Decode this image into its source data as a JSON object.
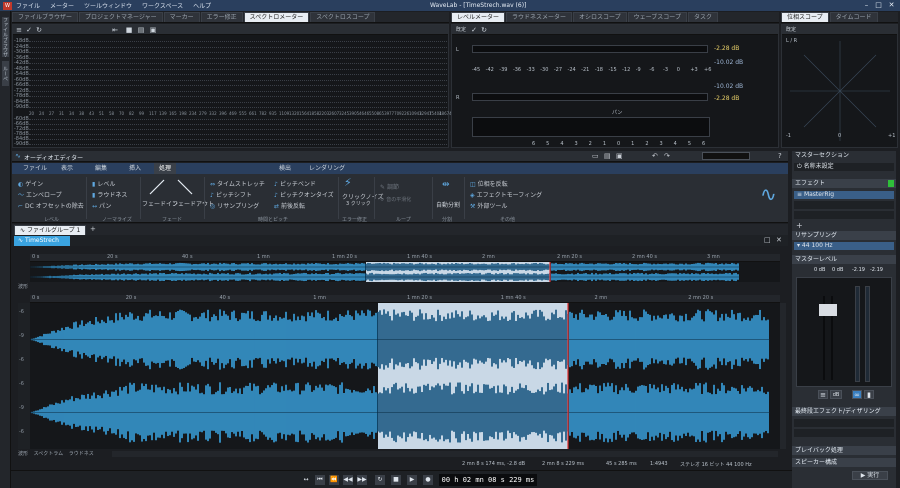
{
  "menu": {
    "items": [
      "ファイル",
      "メーター",
      "ツールウィンドウ",
      "ワークスペース",
      "ヘルプ"
    ],
    "title": "WaveLab - [TimeStrech.wav (6)]"
  },
  "left_strip": {
    "labels": [
      "ファイルブラウザー",
      "ルーペ",
      "TimeStrech"
    ]
  },
  "top_tabs_left": [
    "ファイルブラウザー",
    "プロジェクトマネージャー",
    "マーカー",
    "エラー修正",
    "スペクトロメーター",
    "スペクトロスコープ"
  ],
  "top_tabs_mid": [
    "レベルメーター",
    "ラウドネスメーター",
    "オシロスコープ",
    "ウェーブスコープ",
    "タスク"
  ],
  "top_tabs_right": [
    "位相スコープ",
    "タイムコード"
  ],
  "spectro": {
    "db_labels": [
      "-18dB",
      "-24dB",
      "-30dB",
      "-36dB",
      "-42dB",
      "-48dB",
      "-54dB",
      "-60dB",
      "-66dB",
      "-72dB",
      "-78dB",
      "-84dB",
      "-90dB"
    ],
    "freq_labels": [
      "20 Hz",
      "24 Hz",
      "27 Hz",
      "31 Hz",
      "34 Hz",
      "38 Hz",
      "43 Hz",
      "51 Hz",
      "58 Hz",
      "70 Hz",
      "82 Hz",
      "99 Hz",
      "117 Hz",
      "139 Hz",
      "165 Hz",
      "198 Hz",
      "234 Hz",
      "279 Hz",
      "332 Hz",
      "396 Hz",
      "469 Hz",
      "555 Hz",
      "661 Hz",
      "782 Hz",
      "935 Hz",
      "1109 Hz",
      "1320 Hz",
      "1564 Hz",
      "1858 Hz",
      "2203 Hz",
      "2607 Hz",
      "3245 Hz",
      "3905 Hz",
      "4646 Hz",
      "5508 Hz",
      "6539 Hz",
      "7770 Hz",
      "9226 Hz",
      "10943 Hz",
      "12947 Hz",
      "15404 Hz",
      "18674 Hz"
    ],
    "db_labels2": [
      "-60dB",
      "-66dB",
      "-72dB",
      "-78dB",
      "-84dB",
      "-90dB"
    ]
  },
  "level_meter": {
    "label_l": "L",
    "label_r": "R",
    "scale": [
      "-45",
      "-42",
      "-39",
      "-36",
      "-33",
      "-30",
      "-27",
      "-24",
      "-21",
      "-18",
      "-15",
      "-12",
      "-9",
      "-6",
      "-3",
      "0",
      "+3",
      "+6"
    ],
    "l_peak": "-2.28 dB",
    "l_rms": "-10.02 dB",
    "r_rms": "-10.02 dB",
    "r_peak": "-2.28 dB",
    "pan_label": "パン",
    "pan_scale": [
      "6",
      "5",
      "4",
      "3",
      "2",
      "1",
      "0",
      "1",
      "2",
      "3",
      "4",
      "5",
      "6"
    ],
    "mode_label": "既定"
  },
  "phase_scope": {
    "label": "L / R",
    "mode_label": "既定",
    "scale": [
      "-1",
      "0",
      "+1"
    ]
  },
  "editor": {
    "title": "オーディオエディター",
    "ribbon_tabs": [
      "ファイル",
      "表示",
      "編集",
      "挿入",
      "処理",
      "検出",
      "レンダリング"
    ],
    "active_tab": "処理",
    "buttons": {
      "gain": "ゲイン",
      "envelope": "エンベロープ",
      "dc": "DC オフセットの除去",
      "level": "レベル",
      "loudness": "ラウドネス",
      "pan": "パン",
      "fade_in": "フェードイン",
      "fade_out": "フェードアウト",
      "time_stretch": "タイムストレッチ",
      "pitch_shift": "ピッチシフト",
      "resample": "リサンプリング",
      "pitch_bend": "ピッチベンド",
      "pitch_quantize": "ピッチクオンタイズ",
      "reverse": "前後反転",
      "click_noise": "クリックノイズ",
      "three_click": "3 クリック",
      "adjust": "調節",
      "loop_info": "音の平滑化",
      "auto_split": "自動分割",
      "phase_reverse": "位相を反転",
      "effect_morph": "エフェクトモーフィング",
      "external_tool": "外部ツール"
    },
    "groups": [
      "レベル",
      "ノーマライズ",
      "フェード",
      "時間とピッチ",
      "エラー修正",
      "ループ",
      "分割",
      "その他"
    ],
    "file_group": "ファイルグループ 1",
    "file_tab": "TimeStrech",
    "overview_ruler": [
      "0 s",
      "20 s",
      "40 s",
      "1 mn",
      "1 mn 20 s",
      "1 mn 40 s",
      "2 mn",
      "2 mn 20 s",
      "2 mn 40 s",
      "3 mn"
    ],
    "main_ruler": [
      "0 s",
      "20 s",
      "40 s",
      "1 mn",
      "1 mn 20 s",
      "1 mn 40 s",
      "2 mn",
      "2 mn 20 s"
    ],
    "mini_tabs": [
      "波形",
      "スペクトラム",
      "ラウドネス"
    ],
    "db_axis": [
      "-6",
      "-9",
      "-6",
      "-6",
      "-9",
      "-6"
    ],
    "status": {
      "duration": "2 mn 8 s 174 ms, -2.8 dB",
      "cursor": "2 mn 8 s 229 ms",
      "sel": "45 s 285 ms",
      "zoom": "1:4943",
      "format": "ステレオ 16 ビット 44 100 Hz"
    }
  },
  "master": {
    "title": "マスターセクション",
    "preset": "名称未設定",
    "effects_label": "エフェクト",
    "plugin": "MasterRig",
    "resample_label": "リサンプリング",
    "resample_value": "44 100 Hz",
    "master_level": "マスターレベル",
    "vals": [
      "0 dB",
      "0 dB",
      "-2.19",
      "-2.19"
    ],
    "dither_label": "最終段エフェクト/ディザリング",
    "playback_label": "プレイバック処理",
    "speaker_label": "スピーカー構成",
    "render_button": "実行"
  },
  "transport": {
    "time": "00 h 02 mn 08 s 229 ms"
  },
  "colors": {
    "wave": "#3aa3e0",
    "wave_sel": "#0f4f7a",
    "cursor": "#e03030",
    "accent": "#2a3f5e"
  }
}
